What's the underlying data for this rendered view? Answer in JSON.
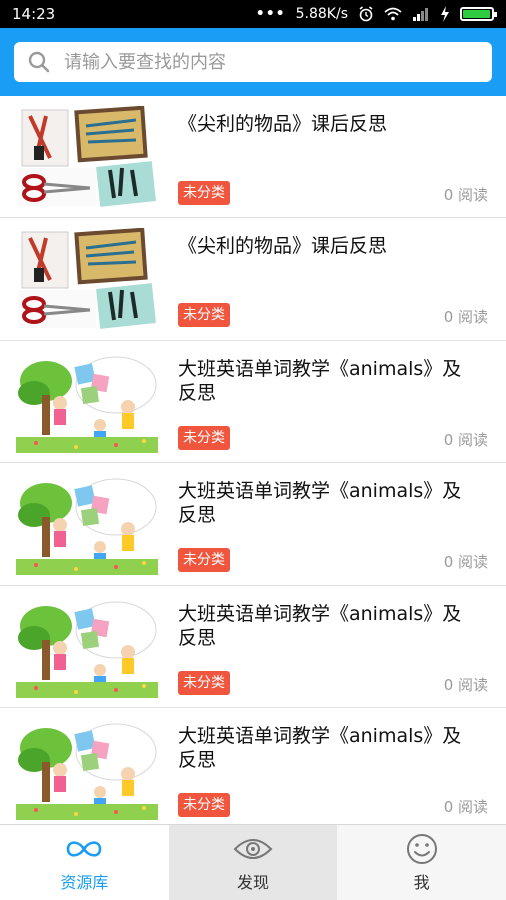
{
  "status_bar": {
    "time": "14:23",
    "dots": "•••",
    "speed": "5.88K/s",
    "battery_level": 0.95
  },
  "search": {
    "placeholder": "请输入要查找的内容"
  },
  "items": [
    {
      "title": "《尖利的物品》课后反思",
      "tag": "未分类",
      "reads": "0 阅读",
      "thumb": "sharp-objects"
    },
    {
      "title": "《尖利的物品》课后反思",
      "tag": "未分类",
      "reads": "0 阅读",
      "thumb": "sharp-objects"
    },
    {
      "title": "大班英语单词教学《animals》及反思",
      "tag": "未分类",
      "reads": "0 阅读",
      "thumb": "kids-abc"
    },
    {
      "title": "大班英语单词教学《animals》及反思",
      "tag": "未分类",
      "reads": "0 阅读",
      "thumb": "kids-abc"
    },
    {
      "title": "大班英语单词教学《animals》及反思",
      "tag": "未分类",
      "reads": "0 阅读",
      "thumb": "kids-abc"
    },
    {
      "title": "大班英语单词教学《animals》及反思",
      "tag": "未分类",
      "reads": "0 阅读",
      "thumb": "kids-abc"
    }
  ],
  "nav": {
    "tabs": [
      {
        "label": "资源库",
        "icon": "infinity-icon",
        "active": true
      },
      {
        "label": "发现",
        "icon": "eye-icon",
        "active": false
      },
      {
        "label": "我",
        "icon": "smiley-icon",
        "active": false
      }
    ],
    "accent": "#1a9ef5"
  }
}
